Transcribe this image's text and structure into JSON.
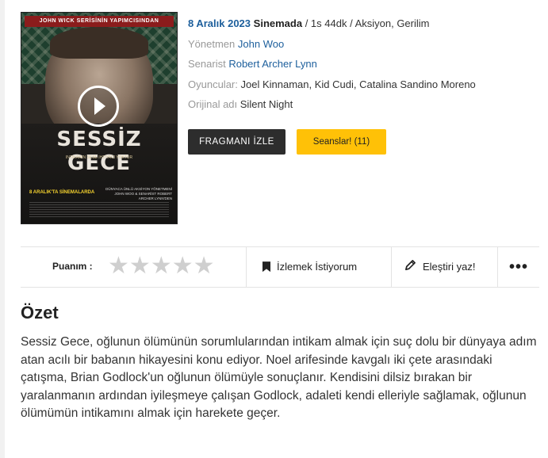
{
  "poster": {
    "tagline": "JOHN WICK SERİSİNİN YAPIMCISINDAN",
    "title": "SESSİZ GECE",
    "subtitle": "INTIKAMIN SESE IHTIYACI YOKTUR",
    "release_note": "8 ARALIK'TA SİNEMALARDA",
    "credits": "DÜNYACA ÜNLÜ AKSİYON YÖNETMENİ JOHN WOO & SENARİST ROBERT ARCHER LYNN'DEN"
  },
  "movie": {
    "release_date": "8 Aralık 2023",
    "status": "Sinemada",
    "meta": "/ 1s 44dk / Aksiyon, Gerilim",
    "director_label": "Yönetmen",
    "director": "John Woo",
    "writer_label": "Senarist",
    "writer": "Robert Archer Lynn",
    "cast_label": "Oyuncular:",
    "cast": "Joel Kinnaman, Kid Cudi, Catalina Sandino Moreno",
    "original_title_label": "Orijinal adı",
    "original_title": "Silent Night"
  },
  "buttons": {
    "trailer": "FRAGMANI İZLE",
    "sessions": "Seanslar! (11)"
  },
  "actions": {
    "rating_label": "Puanım :",
    "stars": 5,
    "watchlist": "İzlemek İstiyorum",
    "review": "Eleştiri yaz!",
    "more": "•••"
  },
  "summary": {
    "title": "Özet",
    "text": "Sessiz Gece, oğlunun ölümünün sorumlularından intikam almak için suç dolu bir dünyaya adım atan acılı bir babanın hikayesini konu ediyor. Noel arifesinde kavgalı iki çete arasındaki çatışma, Brian Godlock'un oğlunun ölümüyle sonuçlanır. Kendisini dilsiz bırakan bir yaralanmanın ardından iyileşmeye çalışan Godlock, adaleti kendi elleriyle sağlamak, oğlunun ölümümün intikamını almak için harekete geçer."
  }
}
